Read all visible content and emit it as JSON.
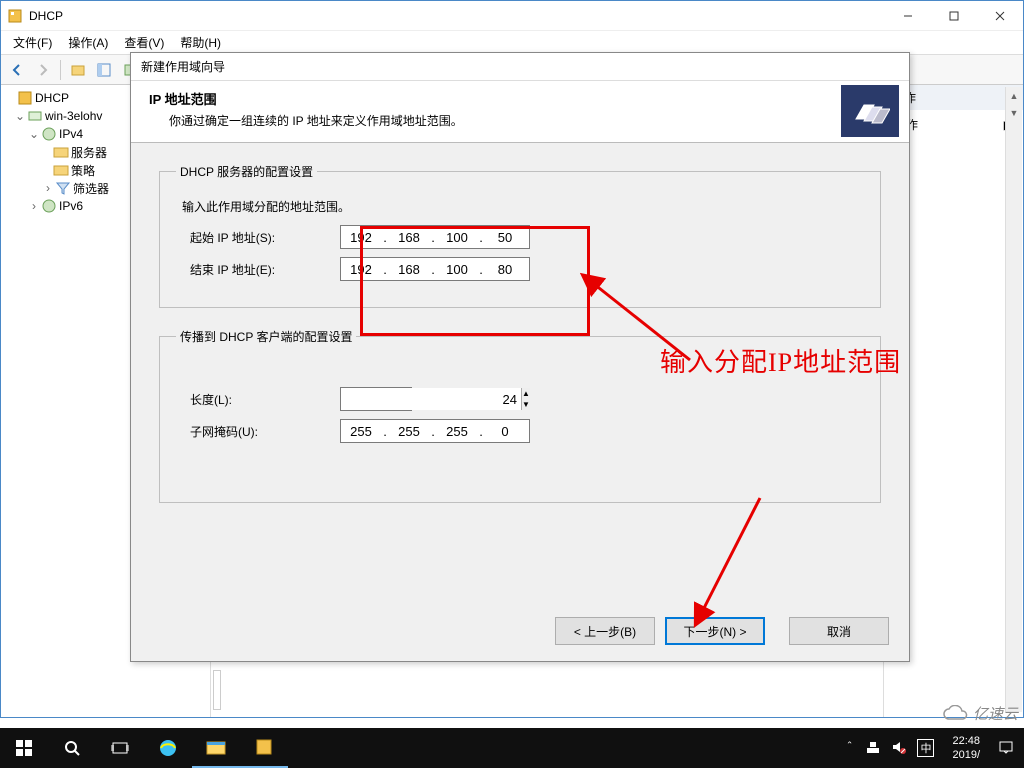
{
  "window": {
    "title": "DHCP"
  },
  "menu": {
    "file": "文件(F)",
    "action": "操作(A)",
    "view": "查看(V)",
    "help": "帮助(H)"
  },
  "tree": {
    "root": "DHCP",
    "server": "win-3elohv",
    "ipv4": "IPv4",
    "serveropt": "服务器",
    "policy": "策略",
    "filter": "筛选器",
    "ipv6": "IPv6"
  },
  "actionpane": {
    "header": "操作",
    "more": "操作"
  },
  "wizard": {
    "title": "新建作用域向导",
    "heading": "IP 地址范围",
    "subheading": "你通过确定一组连续的 IP 地址来定义作用域地址范围。",
    "group1": "DHCP 服务器的配置设置",
    "hint": "输入此作用域分配的地址范围。",
    "start_label": "起始 IP 地址(S):",
    "end_label": "结束 IP 地址(E):",
    "start_ip": {
      "a": "192",
      "b": "168",
      "c": "100",
      "d": "50"
    },
    "end_ip": {
      "a": "192",
      "b": "168",
      "c": "100",
      "d": "80"
    },
    "group2": "传播到 DHCP 客户端的配置设置",
    "length_label": "长度(L):",
    "length_value": "24",
    "mask_label": "子网掩码(U):",
    "mask": {
      "a": "255",
      "b": "255",
      "c": "255",
      "d": "0"
    },
    "back": "< 上一步(B)",
    "next": "下一步(N) >",
    "cancel": "取消"
  },
  "annotation": {
    "text": "输入分配IP地址范围"
  },
  "taskbar": {
    "time": "22:48",
    "date": "2019/"
  },
  "watermark": {
    "text": "亿速云"
  }
}
